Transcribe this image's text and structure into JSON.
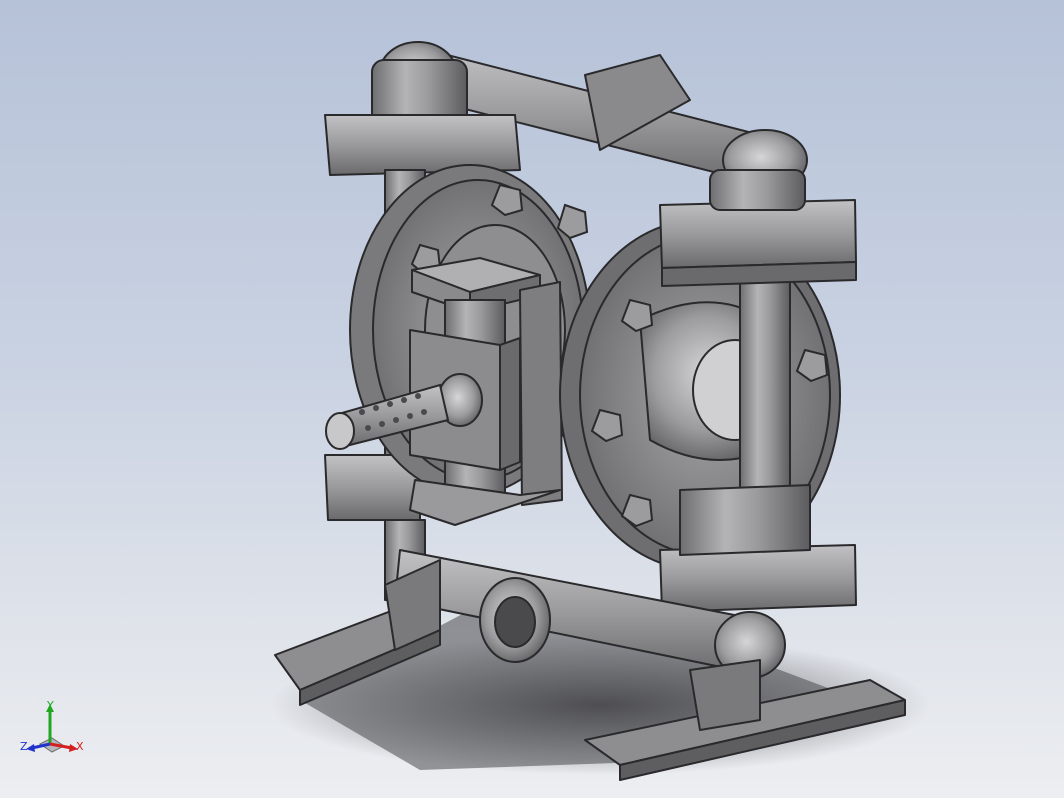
{
  "viewport": {
    "background_top": "#b6c2d8",
    "background_bottom": "#eceef1"
  },
  "model": {
    "material_color": "#8c8c8e"
  },
  "triad": {
    "x_label": "X",
    "y_label": "Y",
    "z_label": "Z",
    "x_color": "#d42020",
    "y_color": "#1fa81f",
    "z_color": "#2233cc"
  }
}
